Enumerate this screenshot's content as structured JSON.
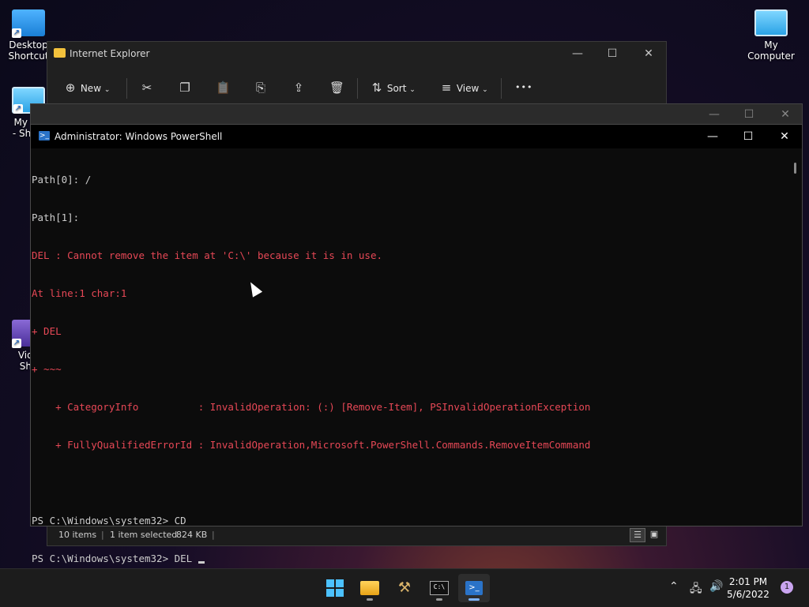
{
  "desktop": {
    "icons": [
      {
        "label": "Desktop\nShortcut",
        "icon": "folder-icon"
      },
      {
        "label": "My Co\n- Short",
        "icon": "monitor-icon"
      },
      {
        "label": "Vide\nSho",
        "icon": "video-icon"
      },
      {
        "label": "My Computer",
        "icon": "monitor-icon"
      }
    ]
  },
  "explorer": {
    "title": "Internet Explorer",
    "toolbar": {
      "new_label": "New",
      "sort_label": "Sort",
      "view_label": "View",
      "more_label": "•••"
    },
    "status": {
      "items": "10 items",
      "selected": "1 item selected",
      "size": "824 KB"
    }
  },
  "powershell": {
    "title": "Administrator: Windows PowerShell",
    "lines": [
      {
        "text": "Path[0]: /",
        "color": "default"
      },
      {
        "text": "Path[1]:",
        "color": "default"
      },
      {
        "text": "DEL : Cannot remove the item at 'C:\\' because it is in use.",
        "color": "red"
      },
      {
        "text": "At line:1 char:1",
        "color": "red"
      },
      {
        "text": "+ DEL",
        "color": "red"
      },
      {
        "text": "+ ~~~",
        "color": "red"
      },
      {
        "text": "    + CategoryInfo          : InvalidOperation: (:) [Remove-Item], PSInvalidOperationException",
        "color": "red"
      },
      {
        "text": "    + FullyQualifiedErrorId : InvalidOperation,Microsoft.PowerShell.Commands.RemoveItemCommand",
        "color": "red"
      },
      {
        "text": "",
        "color": "default"
      },
      {
        "text": "PS C:\\Windows\\system32> CD",
        "color": "default"
      },
      {
        "text": "PS C:\\Windows\\system32> DEL ",
        "color": "default"
      }
    ]
  },
  "taskbar": {
    "time": "2:01 PM",
    "date": "5/6/2022",
    "notification_count": "1"
  }
}
